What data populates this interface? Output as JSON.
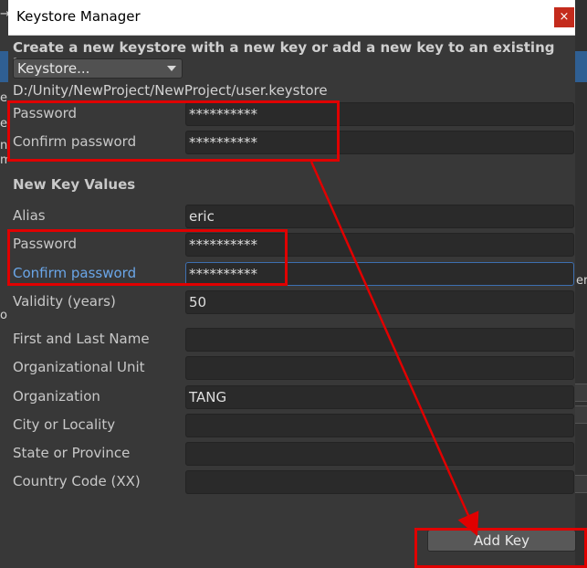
{
  "background": {
    "left_fragments": [
      "→",
      "e",
      "es",
      "n",
      "m",
      "or"
    ],
    "right_fragments": [
      "er"
    ]
  },
  "window": {
    "title": "Keystore Manager",
    "close_glyph": "×"
  },
  "heading": "Create a new keystore with a new key or add a new key to an existing keystore",
  "keystore_dropdown": {
    "value": "Keystore..."
  },
  "keystore_path": "D:/Unity/NewProject/NewProject/user.keystore",
  "keystore": {
    "password_label": "Password",
    "password_value": "**********",
    "confirm_label": "Confirm password",
    "confirm_value": "**********"
  },
  "new_key": {
    "section_title": "New Key Values",
    "alias_label": "Alias",
    "alias_value": "eric",
    "password_label": "Password",
    "password_value": "**********",
    "confirm_label": "Confirm password",
    "confirm_value": "**********",
    "validity_label": "Validity (years)",
    "validity_value": "50",
    "name_label": "First and Last Name",
    "name_value": "",
    "org_unit_label": "Organizational Unit",
    "org_unit_value": "",
    "org_label": "Organization",
    "org_value": "TANG",
    "city_label": "City or Locality",
    "city_value": "",
    "state_label": "State or Province",
    "state_value": "",
    "country_label": "Country Code (XX)",
    "country_value": ""
  },
  "buttons": {
    "add_key": "Add Key"
  },
  "colors": {
    "annotation": "#e00000",
    "focus": "#6aa6e8",
    "close": "#c42b1c"
  }
}
